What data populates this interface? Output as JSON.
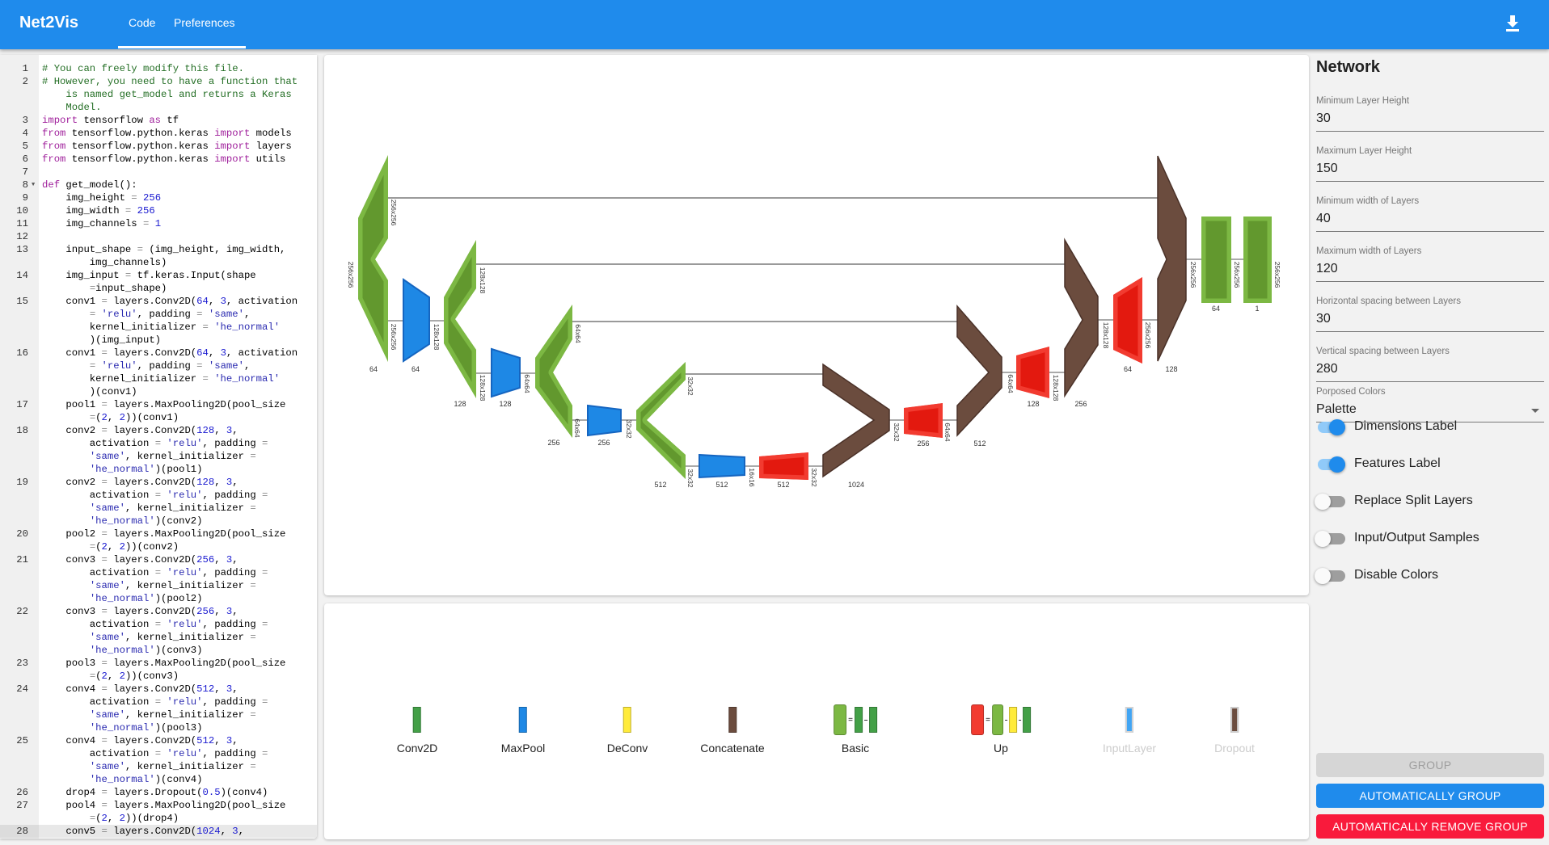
{
  "header": {
    "title": "Net2Vis",
    "tabs": [
      {
        "label": "Code",
        "active": true
      },
      {
        "label": "Preferences",
        "active": false
      }
    ],
    "download_icon": "download-icon"
  },
  "editor": {
    "active_line": 28,
    "lines": [
      {
        "n": 1,
        "rows": [
          "# You can freely modify this file."
        ]
      },
      {
        "n": 2,
        "rows": [
          "# However, you need to have a function that",
          "    is named get_model and returns a Keras",
          "    Model."
        ]
      },
      {
        "n": 3,
        "rows": [
          "import tensorflow as tf"
        ]
      },
      {
        "n": 4,
        "rows": [
          "from tensorflow.python.keras import models"
        ]
      },
      {
        "n": 5,
        "rows": [
          "from tensorflow.python.keras import layers"
        ]
      },
      {
        "n": 6,
        "rows": [
          "from tensorflow.python.keras import utils"
        ]
      },
      {
        "n": 7,
        "rows": [
          ""
        ]
      },
      {
        "n": 8,
        "rows": [
          "def get_model():"
        ],
        "fold": true
      },
      {
        "n": 9,
        "rows": [
          "    img_height = 256"
        ]
      },
      {
        "n": 10,
        "rows": [
          "    img_width = 256"
        ]
      },
      {
        "n": 11,
        "rows": [
          "    img_channels = 1"
        ]
      },
      {
        "n": 12,
        "rows": [
          ""
        ]
      },
      {
        "n": 13,
        "rows": [
          "    input_shape = (img_height, img_width,",
          "        img_channels)"
        ]
      },
      {
        "n": 14,
        "rows": [
          "    img_input = tf.keras.Input(shape",
          "        =input_shape)"
        ]
      },
      {
        "n": 15,
        "rows": [
          "    conv1 = layers.Conv2D(64, 3, activation",
          "        = 'relu', padding = 'same',",
          "        kernel_initializer = 'he_normal'",
          "        )(img_input)"
        ]
      },
      {
        "n": 16,
        "rows": [
          "    conv1 = layers.Conv2D(64, 3, activation",
          "        = 'relu', padding = 'same',",
          "        kernel_initializer = 'he_normal'",
          "        )(conv1)"
        ]
      },
      {
        "n": 17,
        "rows": [
          "    pool1 = layers.MaxPooling2D(pool_size",
          "        =(2, 2))(conv1)"
        ]
      },
      {
        "n": 18,
        "rows": [
          "    conv2 = layers.Conv2D(128, 3,",
          "        activation = 'relu', padding =",
          "        'same', kernel_initializer =",
          "        'he_normal')(pool1)"
        ]
      },
      {
        "n": 19,
        "rows": [
          "    conv2 = layers.Conv2D(128, 3,",
          "        activation = 'relu', padding =",
          "        'same', kernel_initializer =",
          "        'he_normal')(conv2)"
        ]
      },
      {
        "n": 20,
        "rows": [
          "    pool2 = layers.MaxPooling2D(pool_size",
          "        =(2, 2))(conv2)"
        ]
      },
      {
        "n": 21,
        "rows": [
          "    conv3 = layers.Conv2D(256, 3,",
          "        activation = 'relu', padding =",
          "        'same', kernel_initializer =",
          "        'he_normal')(pool2)"
        ]
      },
      {
        "n": 22,
        "rows": [
          "    conv3 = layers.Conv2D(256, 3,",
          "        activation = 'relu', padding =",
          "        'same', kernel_initializer =",
          "        'he_normal')(conv3)"
        ]
      },
      {
        "n": 23,
        "rows": [
          "    pool3 = layers.MaxPooling2D(pool_size",
          "        =(2, 2))(conv3)"
        ]
      },
      {
        "n": 24,
        "rows": [
          "    conv4 = layers.Conv2D(512, 3,",
          "        activation = 'relu', padding =",
          "        'same', kernel_initializer =",
          "        'he_normal')(pool3)"
        ]
      },
      {
        "n": 25,
        "rows": [
          "    conv4 = layers.Conv2D(512, 3,",
          "        activation = 'relu', padding =",
          "        'same', kernel_initializer =",
          "        'he_normal')(conv4)"
        ]
      },
      {
        "n": 26,
        "rows": [
          "    drop4 = layers.Dropout(0.5)(conv4)"
        ]
      },
      {
        "n": 27,
        "rows": [
          "    pool4 = layers.MaxPooling2D(pool_size",
          "        =(2, 2))(drop4)"
        ]
      },
      {
        "n": 28,
        "rows": [
          "    conv5 = layers.Conv2D(1024, 3,"
        ]
      }
    ]
  },
  "colors": {
    "conv": "#7cb843",
    "conv_inner": "#62982e",
    "maxpool": "#1e88e5",
    "deconv": "#f23b30",
    "deconv_inner": "#e3190f",
    "concat": "#6b4c3e",
    "accent": "#1f8bec",
    "danger": "#f91a3c"
  },
  "network": {
    "layers": [
      {
        "type": "conv",
        "features": "64",
        "dims": [
          "256x256",
          "256x256",
          "256x256"
        ]
      },
      {
        "type": "maxpool",
        "features": "64",
        "dims": [
          "128x128"
        ]
      },
      {
        "type": "conv",
        "features": "128",
        "dims": [
          "128x128",
          "128x128"
        ]
      },
      {
        "type": "maxpool",
        "features": "128",
        "dims": [
          "64x64"
        ]
      },
      {
        "type": "conv",
        "features": "256",
        "dims": [
          "64x64",
          "64x64"
        ]
      },
      {
        "type": "maxpool",
        "features": "256",
        "dims": [
          "32x32"
        ]
      },
      {
        "type": "conv",
        "features": "512",
        "dims": [
          "32x32",
          "32x32"
        ]
      },
      {
        "type": "maxpool",
        "features": "512",
        "dims": [
          "16x16"
        ]
      },
      {
        "type": "deconv",
        "features": "512",
        "dims": [
          "32x32"
        ]
      },
      {
        "type": "concat",
        "features": "1024",
        "dims": [
          "32x32"
        ]
      },
      {
        "type": "deconv",
        "features": "256",
        "dims": [
          "64x64"
        ]
      },
      {
        "type": "concat",
        "features": "512",
        "dims": [
          "64x64"
        ]
      },
      {
        "type": "deconv",
        "features": "128",
        "dims": [
          "128x128"
        ]
      },
      {
        "type": "concat",
        "features": "256",
        "dims": [
          "128x128"
        ]
      },
      {
        "type": "deconv",
        "features": "64",
        "dims": [
          "256x256"
        ]
      },
      {
        "type": "concat",
        "features": "128",
        "dims": [
          "256x256"
        ]
      },
      {
        "type": "conv",
        "features": "64",
        "dims": [
          "256x256"
        ]
      },
      {
        "type": "conv",
        "features": "1",
        "dims": [
          "256x256"
        ]
      }
    ]
  },
  "legend": {
    "items": [
      {
        "label": "Conv2D",
        "kind": "conv",
        "disabled": false
      },
      {
        "label": "MaxPool",
        "kind": "maxpool",
        "disabled": false
      },
      {
        "label": "DeConv",
        "kind": "deconv-yellow",
        "disabled": false
      },
      {
        "label": "Concatenate",
        "kind": "concat",
        "disabled": false
      },
      {
        "label": "Basic",
        "kind": "group-basic",
        "disabled": false
      },
      {
        "label": "Up",
        "kind": "group-up",
        "disabled": false
      },
      {
        "label": "InputLayer",
        "kind": "input",
        "disabled": true
      },
      {
        "label": "Dropout",
        "kind": "dropout",
        "disabled": true
      }
    ]
  },
  "panel": {
    "title": "Network",
    "fields": [
      {
        "label": "Minimum Layer Height",
        "value": "30"
      },
      {
        "label": "Maximum Layer Height",
        "value": "150"
      },
      {
        "label": "Minimum width of Layers",
        "value": "40"
      },
      {
        "label": "Maximum width of Layers",
        "value": "120"
      },
      {
        "label": "Horizontal spacing between Layers",
        "value": "30"
      },
      {
        "label": "Vertical spacing between Layers",
        "value": "280"
      }
    ],
    "select": {
      "label": "Porposed Colors",
      "value": "Palette"
    },
    "toggles": [
      {
        "label": "Dimensions Label",
        "on": true
      },
      {
        "label": "Features Label",
        "on": true
      },
      {
        "label": "Replace Split Layers",
        "on": false
      },
      {
        "label": "Input/Output Samples",
        "on": false
      },
      {
        "label": "Disable Colors",
        "on": false
      }
    ],
    "buttons": {
      "group": "GROUP",
      "auto_group": "AUTOMATICALLY GROUP",
      "remove_group": "AUTOMATICALLY REMOVE GROUP"
    }
  }
}
